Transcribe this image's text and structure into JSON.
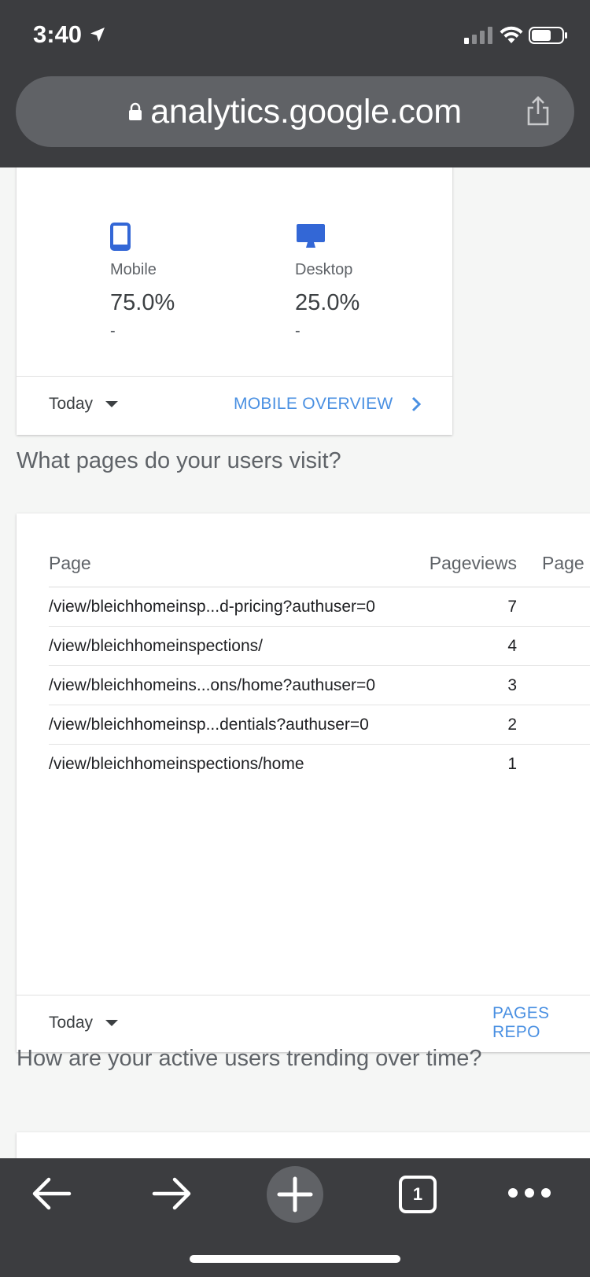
{
  "status_bar": {
    "time": "3:40"
  },
  "browser": {
    "url": "analytics.google.com"
  },
  "devices_card": {
    "devices": [
      {
        "name": "Mobile",
        "value": "75.0%",
        "change": "-",
        "icon": "phone-icon"
      },
      {
        "name": "Desktop",
        "value": "25.0%",
        "change": "-",
        "icon": "desktop-icon"
      }
    ],
    "date_range": "Today",
    "link_label": "MOBILE OVERVIEW"
  },
  "pages_section": {
    "title": "What pages do your users visit?",
    "columns": [
      "Page",
      "Pageviews",
      "Page"
    ],
    "rows": [
      {
        "page": "/view/bleichhomeinsp...d-pricing?authuser=0",
        "views": "7"
      },
      {
        "page": "/view/bleichhomeinspections/",
        "views": "4"
      },
      {
        "page": "/view/bleichhomeins...ons/home?authuser=0",
        "views": "3"
      },
      {
        "page": "/view/bleichhomeinsp...dentials?authuser=0",
        "views": "2"
      },
      {
        "page": "/view/bleichhomeinspections/home",
        "views": "1"
      }
    ],
    "date_range": "Today",
    "link_label": "PAGES REPO"
  },
  "trend_section": {
    "title": "How are your active users trending over time?"
  },
  "toolbar": {
    "tab_count": "1"
  },
  "colors": {
    "chrome": "#3c3d40",
    "accent_link": "#4a90e2",
    "device_icon": "#3367d6"
  }
}
